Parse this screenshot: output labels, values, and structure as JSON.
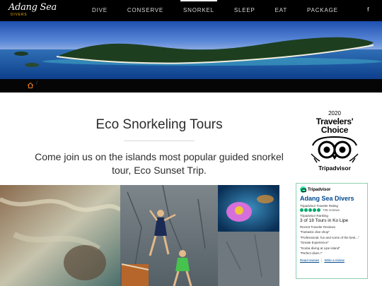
{
  "header": {
    "logo_script": "Adang Sea",
    "logo_sub": "DIVERS",
    "menu": [
      {
        "label": "DIVE"
      },
      {
        "label": "CONSERVE"
      },
      {
        "label": "SNORKEL"
      },
      {
        "label": "SLEEP"
      },
      {
        "label": "EAT"
      },
      {
        "label": "PACKAGE"
      }
    ],
    "active_menu": "SNORKEL",
    "facebook_glyph": "f"
  },
  "breadcrumb": {
    "home_icon": "home-icon",
    "separator": "/"
  },
  "main": {
    "title": "Eco Snorkeling Tours",
    "intro": "Come join us on the islands most popular guided snorkel tour, Eco Sunset Trip."
  },
  "award": {
    "year": "2020",
    "title_line1": "Travelers'",
    "title_line2": "Choice",
    "brand": "Tripadvisor"
  },
  "tripadvisor_widget": {
    "brand": "Tripadvisor",
    "business": "Adang Sea Divers",
    "rating_label": "Tripadvisor Traveler Rating",
    "bubbles": 5,
    "reviews": "739 reviews",
    "ranking_label": "Tripadvisor Ranking",
    "ranking": "3 of 18 Tours in Ko Lipe",
    "recent_label": "Recent Traveler Reviews",
    "quotes": [
      "\"Fantastic dive shop\"",
      "\"Professional, fun and some of the best...\"",
      "\"Greate Experience\"",
      "\"Scuba diving at Lipe island\"",
      "\"Perfect dives !\""
    ],
    "read_reviews": "Read reviews",
    "write_review": "Write a review"
  },
  "colors": {
    "nav_bg": "#000000",
    "accent_logo": "#f5b301",
    "ta_green": "#00aa6c",
    "ta_link": "#00488e"
  }
}
